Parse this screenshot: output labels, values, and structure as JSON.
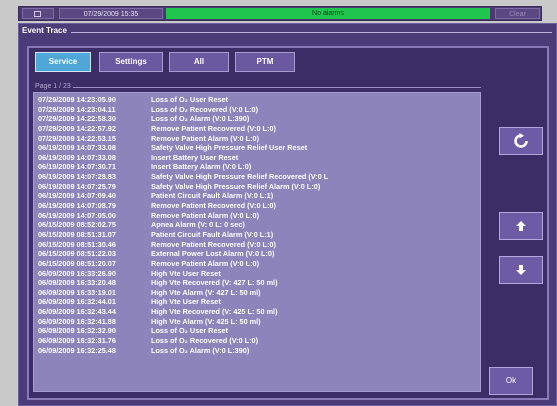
{
  "topbar": {
    "datetime": "07/29/2009 15:35",
    "alarm_status": "No alarms",
    "clear_label": "Clear",
    "alarm_color": "#1fc64d"
  },
  "window": {
    "title": "Event Trace"
  },
  "tabs": [
    {
      "label": "Service",
      "active": true
    },
    {
      "label": "Settings",
      "active": false
    },
    {
      "label": "All",
      "active": false
    },
    {
      "label": "PTM",
      "active": false
    }
  ],
  "page": {
    "label": "Page  1 / 23"
  },
  "events": [
    {
      "ts": "07/29/2009  14:23:05.90",
      "msg": "Loss of O₂ User Reset"
    },
    {
      "ts": "07/29/2009  14:23:04.11",
      "msg": "Loss of O₂ Recovered (V:0 L:0)"
    },
    {
      "ts": "07/29/2009  14:22:58.30",
      "msg": "Loss of O₂ Alarm (V:0 L:390)"
    },
    {
      "ts": "07/29/2009  14:22:57.92",
      "msg": "Remove Patient Recovered (V:0 L:0)"
    },
    {
      "ts": "07/29/2009  14:22:53.15",
      "msg": "Remove Patient Alarm (V:0 L:0)"
    },
    {
      "ts": "06/19/2009  14:07:33.08",
      "msg": "Safety Valve High Pressure Relief User Reset"
    },
    {
      "ts": "06/19/2009  14:07:33.08",
      "msg": "Insert Battery User Reset"
    },
    {
      "ts": "06/19/2009  14:07:30.71",
      "msg": "Insert Battery Alarm (V:0 L:0)"
    },
    {
      "ts": "06/19/2009  14:07:28.83",
      "msg": "Safety Valve High Pressure Relief Recovered (V:0 L"
    },
    {
      "ts": "06/19/2009  14:07:25.79",
      "msg": "Safety Valve High Pressure Relief Alarm (V:0 L:0)"
    },
    {
      "ts": "06/19/2009  14:07:09.40",
      "msg": "Patient Circuit Fault Alarm (V:0 L:1)"
    },
    {
      "ts": "06/19/2009  14:07:08.79",
      "msg": "Remove Patient Recovered (V:0 L:0)"
    },
    {
      "ts": "06/19/2009  14:07:05.00",
      "msg": "Remove Patient Alarm (V:0 L:0)"
    },
    {
      "ts": "06/15/2009  08:52:02.75",
      "msg": "Apnea Alarm (V: 0  L: 0 sec)"
    },
    {
      "ts": "06/15/2009  08:51:31.07",
      "msg": "Patient Circuit Fault Alarm (V:0 L:1)"
    },
    {
      "ts": "06/15/2009  08:51:30.46",
      "msg": "Remove Patient Recovered (V:0 L:0)"
    },
    {
      "ts": "06/15/2009  08:51:22.03",
      "msg": "External Power Lost Alarm (V:0 L:0)"
    },
    {
      "ts": "06/15/2009  08:51:20.07",
      "msg": "Remove Patient Alarm (V:0 L:0)"
    },
    {
      "ts": "06/09/2009  16:33:26.90",
      "msg": "High Vte User Reset"
    },
    {
      "ts": "06/09/2009  16:33:20.48",
      "msg": "High Vte Recovered (V: 427  L:  50 ml)"
    },
    {
      "ts": "06/09/2009  16:33:19.01",
      "msg": "High Vte Alarm (V: 427  L:  50 ml)"
    },
    {
      "ts": "06/09/2009  16:32:44.01",
      "msg": "High Vte User Reset"
    },
    {
      "ts": "06/09/2009  16:32:43.44",
      "msg": "High Vte Recovered (V: 425  L:  50 ml)"
    },
    {
      "ts": "06/09/2009  16:32:41.88",
      "msg": "High Vte Alarm (V: 425  L:  50 ml)"
    },
    {
      "ts": "06/09/2009  16:32:32.90",
      "msg": "Loss of O₂ User Reset"
    },
    {
      "ts": "06/09/2009  16:32:31.76",
      "msg": "Loss of O₂ Recovered (V:0 L:0)"
    },
    {
      "ts": "06/09/2009  16:32:25.48",
      "msg": "Loss of O₂ Alarm (V:0 L:390)"
    }
  ],
  "buttons": {
    "refresh_icon": "refresh-icon",
    "page_up_icon": "arrow-up-icon",
    "page_down_icon": "arrow-down-icon",
    "ok_label": "Ok"
  },
  "colors": {
    "panel_bg": "#3d2d66",
    "log_bg": "#8d84bb",
    "active_tab": "#4fa7d8"
  }
}
